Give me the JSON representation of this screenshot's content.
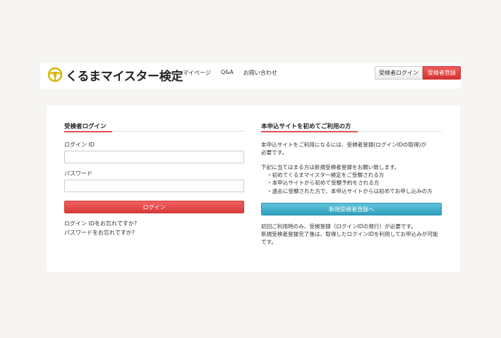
{
  "header": {
    "logo_text": "くるまマイスター検定",
    "nav": [
      "マイページ",
      "Q&A",
      "お問い合わせ"
    ],
    "login_button": "受検者ログイン",
    "register_button": "受検者登録"
  },
  "login": {
    "title": "受検者ログイン",
    "id_label": "ログイン ID",
    "id_value": "",
    "password_label": "パスワード",
    "password_value": "",
    "submit": "ログイン",
    "forgot_id": "ログイン IDをお忘れですか?",
    "forgot_password": "パスワードをお忘れですか?"
  },
  "first_time": {
    "title": "本申込サイトを初めてご利用の方",
    "intro_1": "本申込サイトをご利用になるには、受検者登録(ログインIDの取得)が",
    "intro_2": "必要です。",
    "cond_heading": "下記に当てはまる方は新規受検者登録をお願い致します。",
    "cond_1": "・初めてくるまマイスター検定をご受験される方",
    "cond_2": "・本申込サイトから初めて受験予約をされる方",
    "cond_3": "・過去に受験された方で、本申込サイトからは初めてお申し込みの方",
    "new_button": "新規受検者登録へ",
    "note_1": "初回ご利用時のみ、受検登録（ログインIDの発行）が必要です。",
    "note_2": "新規受検者登録完了後は、取得したログインIDを利用してお申込みが可能",
    "note_3": "です。"
  },
  "colors": {
    "accent_red": "#e04848",
    "accent_blue": "#3aa8c6",
    "logo_yellow": "#d8b400"
  }
}
